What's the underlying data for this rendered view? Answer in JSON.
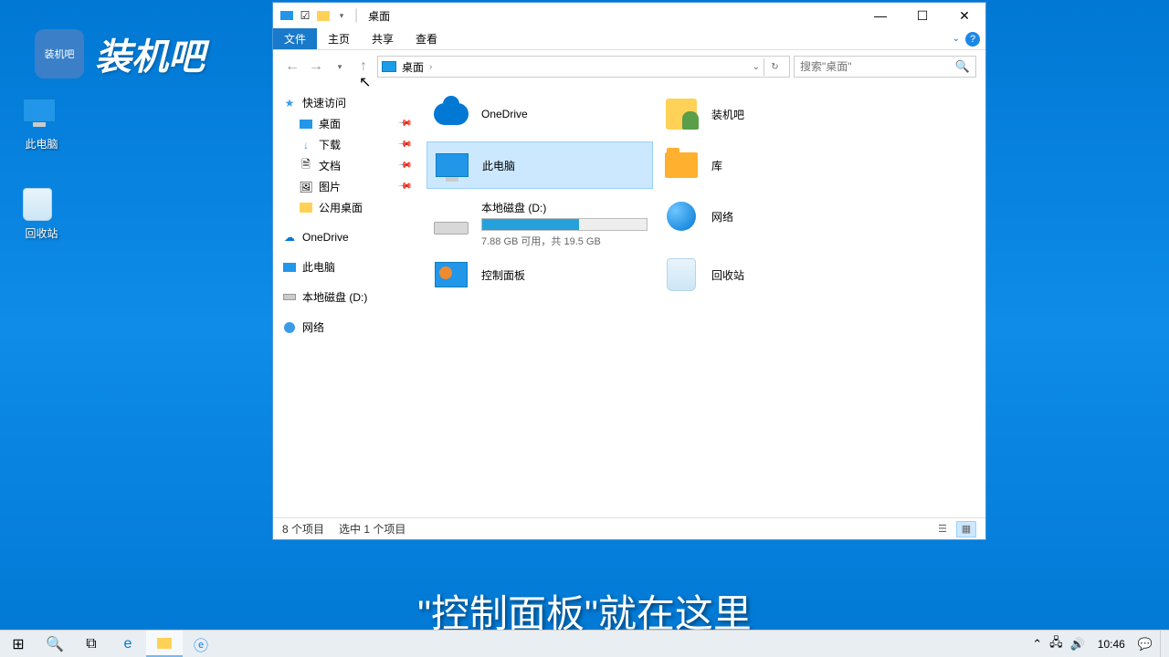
{
  "desktop": {
    "icons": [
      {
        "label": "此电脑"
      },
      {
        "label": "回收站"
      }
    ],
    "watermark_text": "装机吧",
    "watermark_badge": "装机吧",
    "subtitle": "\"控制面板\"就在这里"
  },
  "window": {
    "title": "桌面",
    "ribbon": {
      "file": "文件",
      "home": "主页",
      "share": "共享",
      "view": "查看"
    },
    "nav": {
      "back": "←",
      "forward": "→",
      "up": "↑"
    },
    "address": {
      "location": "桌面"
    },
    "search_placeholder": "搜索\"桌面\"",
    "nav_pane": {
      "quick": "快速访问",
      "quick_items": [
        {
          "label": "桌面",
          "pinned": true
        },
        {
          "label": "下载",
          "pinned": true
        },
        {
          "label": "文档",
          "pinned": true
        },
        {
          "label": "图片",
          "pinned": true
        },
        {
          "label": "公用桌面",
          "pinned": false
        }
      ],
      "onedrive": "OneDrive",
      "thispc": "此电脑",
      "drive": "本地磁盘 (D:)",
      "network": "网络"
    },
    "items": {
      "onedrive": "OneDrive",
      "zhuangji": "装机吧",
      "thispc": "此电脑",
      "libs": "库",
      "drive_name": "本地磁盘 (D:)",
      "drive_sub": "7.88 GB 可用，共 19.5 GB",
      "drive_pct": 59,
      "network": "网络",
      "cpanel": "控制面板",
      "recycle": "回收站"
    },
    "status": {
      "left": "8 个项目",
      "selection": "选中 1 个项目"
    }
  },
  "taskbar": {
    "clock": "10:46"
  }
}
